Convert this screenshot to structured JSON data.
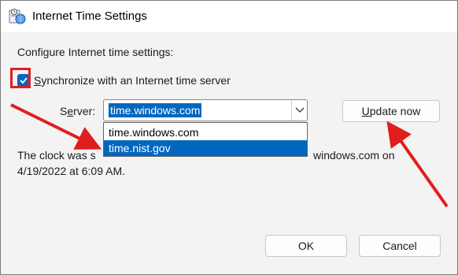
{
  "window": {
    "title": "Internet Time Settings"
  },
  "dialog": {
    "section_title": "Configure Internet time settings:",
    "sync_checkbox": {
      "checked": true,
      "label_prefix": "",
      "label_mnemonic": "S",
      "label_rest": "ynchronize with an Internet time server"
    },
    "server": {
      "label_mnemonic": "e",
      "label_before": "S",
      "label_after": "rver:",
      "value": "time.windows.com",
      "options": [
        "time.windows.com",
        "time.nist.gov"
      ],
      "highlighted_option": "time.nist.gov"
    },
    "update_button": {
      "mnemonic": "U",
      "rest": "pdate now"
    },
    "status": {
      "line1_left": "The clock was s",
      "line1_right": "windows.com on",
      "line2": "4/19/2022 at 6:09 AM."
    },
    "ok_label": "OK",
    "cancel_label": "Cancel"
  },
  "colors": {
    "accent": "#0067c0",
    "annotation_red": "#e01e1e"
  },
  "icons": {
    "app": "clock-globe-icon",
    "checkmark": "checkmark-icon",
    "dropdown": "chevron-down-icon"
  }
}
